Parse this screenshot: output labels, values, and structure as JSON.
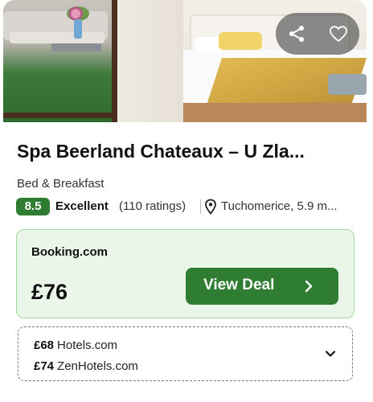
{
  "hotel": {
    "name": "Spa Beerland Chateaux – U Zla...",
    "property_type": "Bed & Breakfast",
    "rating": {
      "score": "8.5",
      "label": "Excellent",
      "count_text": "(110 ratings)"
    },
    "location": "Tuchomerice, 5.9 m..."
  },
  "photo": {
    "actions": {
      "share_icon": "share-icon",
      "favorite_icon": "heart-outline-icon"
    }
  },
  "best_deal": {
    "provider": "Booking.com",
    "price": "£76",
    "button_label": "View Deal"
  },
  "other_deals": [
    {
      "price": "£68",
      "provider": "Hotels.com"
    },
    {
      "price": "£74",
      "provider": "ZenHotels.com"
    }
  ],
  "colors": {
    "accent_green": "#2f7d32",
    "deal_background": "#eaf7e8",
    "deal_border": "#9fd89a"
  }
}
